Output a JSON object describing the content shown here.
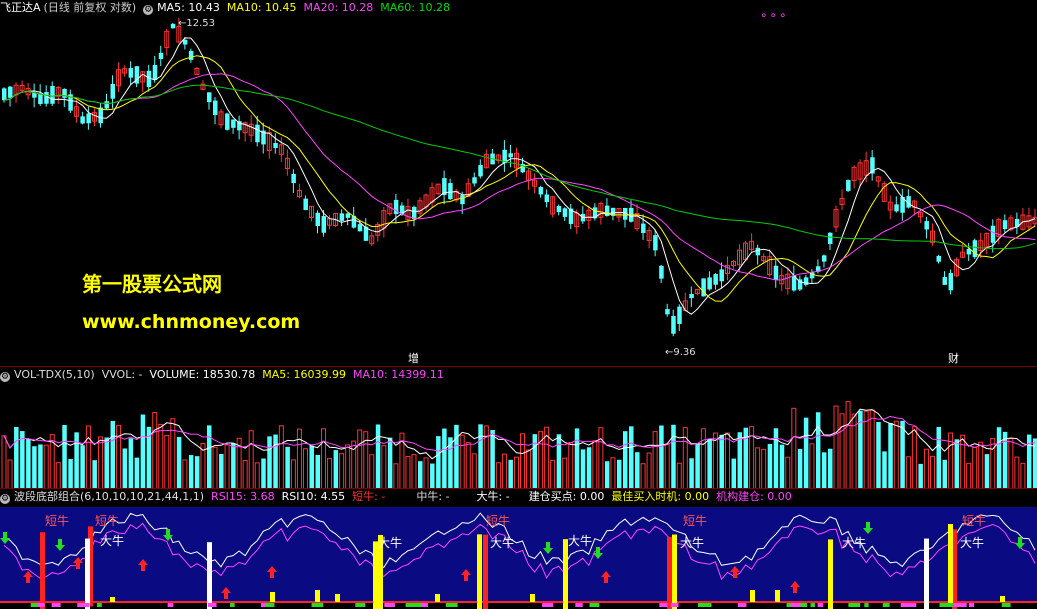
{
  "main_header": {
    "name": "飞正达A",
    "mode": "(日线 前复权 对数)",
    "ma5": "MA5: 10.43",
    "ma10": "MA10: 10.45",
    "ma20": "MA20: 10.28",
    "ma60": "MA60: 10.28"
  },
  "watermark": {
    "line1": "第一股票公式网",
    "line2": "www.chnmoney.com"
  },
  "price_marks": {
    "high": "12.53",
    "low": "9.36",
    "event1": "增",
    "event2": "财",
    "dots": "∘∘∘"
  },
  "vol_header": {
    "name": "VOL-TDX(5,10)",
    "vvol": "VVOL: -",
    "volume": "VOLUME: 18530.78",
    "ma5": "MA5: 16039.99",
    "ma10": "MA10: 14399.11"
  },
  "ind_header": {
    "name": "波段底部组合(6,10,10,10,21,44,1,1)",
    "rsi15": "RSI15: 3.68",
    "rsi10": "RSI10: 4.55",
    "short": "短牛: -",
    "mid": "中牛: -",
    "big": "大牛: -",
    "buy_point": "建仓买点: 0.00",
    "best_time": "最佳买入时机: 0.00",
    "inst": "机构建仓: 0.00"
  },
  "ind_labels": {
    "short_bull": "短牛",
    "big_bull": "大牛"
  },
  "colors": {
    "up": "#ff3333",
    "down": "#54ffff",
    "ma5": "#ffffff",
    "ma10": "#ffff00",
    "ma20": "#ff44ff",
    "ma60": "#00cc00",
    "ind_bg": "#0a0a82"
  },
  "chart_data": {
    "type": "candlestick",
    "price_high": 12.53,
    "price_low": 9.36,
    "ma_last": {
      "MA5": 10.43,
      "MA10": 10.45,
      "MA20": 10.28,
      "MA60": 10.28
    },
    "volume_last": 18530.78,
    "vol_ma_last": {
      "MA5": 16039.99,
      "MA10": 14399.11
    },
    "rsi_last": {
      "RSI15": 3.68,
      "RSI10": 4.55
    }
  }
}
